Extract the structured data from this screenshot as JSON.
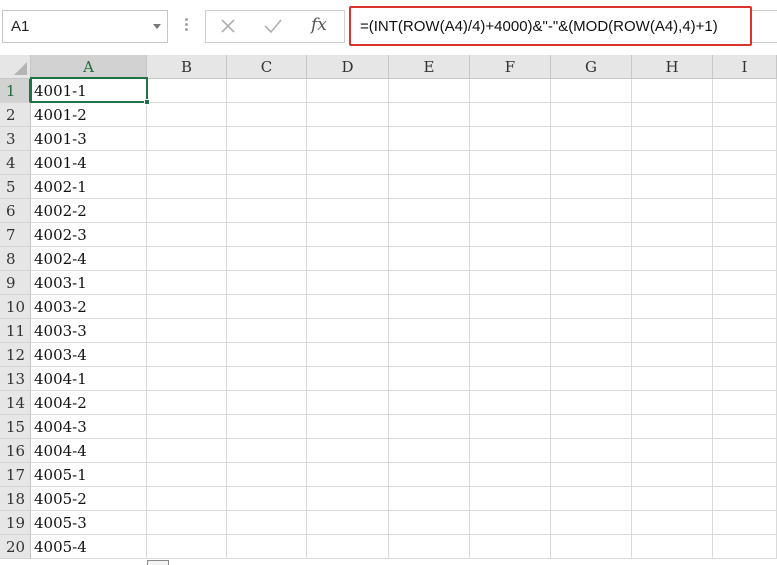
{
  "formula_bar": {
    "name_box": "A1",
    "cancel_icon": "x-icon",
    "enter_icon": "checkmark-icon",
    "function_label": "fx",
    "formula": "=(INT(ROW(A4)/4)+4000)&\"-\"&(MOD(ROW(A4),4)+1)",
    "highlight_color": "#e0322d"
  },
  "sheet": {
    "columns": [
      "A",
      "B",
      "C",
      "D",
      "E",
      "F",
      "G",
      "H",
      "I"
    ],
    "rows": [
      "1",
      "2",
      "3",
      "4",
      "5",
      "6",
      "7",
      "8",
      "9",
      "10",
      "11",
      "12",
      "13",
      "14",
      "15",
      "16",
      "17",
      "18",
      "19",
      "20"
    ],
    "column_a_values": [
      "4001-1",
      "4001-2",
      "4001-3",
      "4001-4",
      "4002-1",
      "4002-2",
      "4002-3",
      "4002-4",
      "4003-1",
      "4003-2",
      "4003-3",
      "4003-4",
      "4004-1",
      "4004-2",
      "4004-3",
      "4004-4",
      "4005-1",
      "4005-2",
      "4005-3",
      "4005-4"
    ],
    "active_cell": "A1",
    "selection_color": "#217346"
  }
}
